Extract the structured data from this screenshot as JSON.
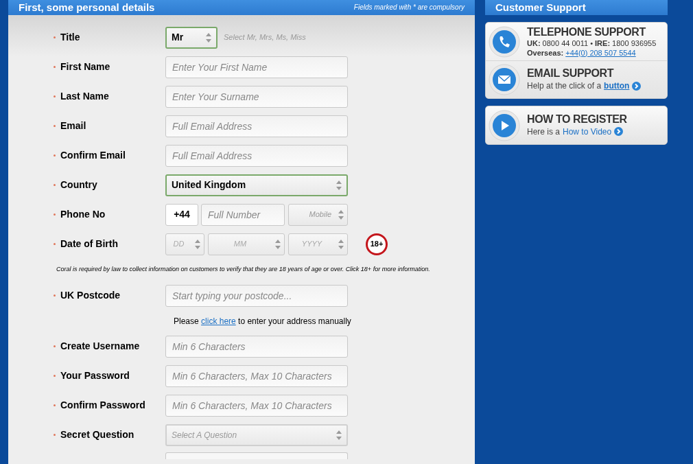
{
  "form": {
    "title": "First, some personal details",
    "compulsory_note": "Fields marked with * are compulsory",
    "rows": [
      {
        "kind": "select",
        "label": "Title",
        "required": true,
        "value": "Mr",
        "hint": "Select Mr, Mrs, Ms, Miss",
        "highlighted": true
      },
      {
        "kind": "text",
        "label": "First Name",
        "required": true,
        "placeholder": "Enter Your First Name"
      },
      {
        "kind": "text",
        "label": "Last Name",
        "required": true,
        "placeholder": "Enter Your Surname"
      },
      {
        "kind": "text",
        "label": "Email",
        "required": true,
        "placeholder": "Full Email Address"
      },
      {
        "kind": "text",
        "label": "Confirm Email",
        "required": true,
        "placeholder": "Full Email Address"
      },
      {
        "kind": "select",
        "label": "Country",
        "required": true,
        "value": "United Kingdom",
        "highlighted": true
      },
      {
        "kind": "phone",
        "label": "Phone No",
        "required": true,
        "code": "+44",
        "placeholder": "Full Number",
        "type_placeholder": "Mobile"
      },
      {
        "kind": "dob",
        "label": "Date of Birth",
        "required": true,
        "parts": [
          "DD",
          "MM",
          "YYYY"
        ],
        "badge": "18+"
      },
      {
        "kind": "note",
        "text": "Coral is required by law to collect information on customers to verify that they are 18 years of age or over. Click 18+ for more information."
      },
      {
        "kind": "text",
        "label": "UK Postcode",
        "required": true,
        "placeholder": "Start typing your postcode..."
      },
      {
        "kind": "link",
        "before": "Please",
        "link": "click here",
        "after": "to enter your address manually"
      },
      {
        "kind": "text",
        "label": "Create Username",
        "required": true,
        "placeholder": "Min 6 Characters"
      },
      {
        "kind": "text",
        "label": "Your Password",
        "required": true,
        "placeholder": "Min 6 Characters, Max 10 Characters"
      },
      {
        "kind": "text",
        "label": "Confirm Password",
        "required": true,
        "placeholder": "Min 6 Characters, Max 10 Characters"
      },
      {
        "kind": "select",
        "label": "Secret Question",
        "required": true,
        "placeholder": "Select A Question",
        "highlighted": false
      },
      {
        "kind": "blank"
      }
    ]
  },
  "support": {
    "title": "Customer Support",
    "groups": [
      [
        {
          "kind": "phone",
          "heading": "TELEPHONE SUPPORT",
          "line": "**UK:** 0800  44 0011 • **IRE:** 1800 936955",
          "label": "Overseas:",
          "link": "+44(0) 208 507 5544"
        },
        {
          "kind": "email",
          "heading": "EMAIL SUPPORT",
          "text": "Help at the click of a",
          "link": "button"
        }
      ],
      [
        {
          "kind": "video",
          "heading": "HOW TO REGISTER",
          "text": "Here is a",
          "link": "How to Video"
        }
      ]
    ]
  }
}
